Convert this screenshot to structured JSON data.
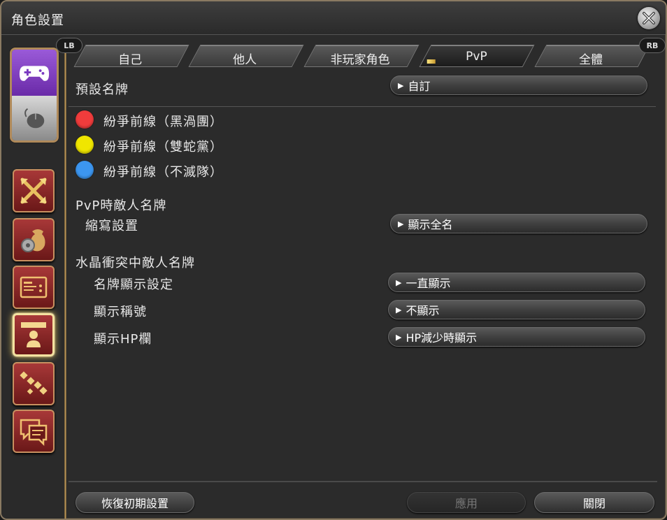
{
  "window": {
    "title": "角色設置"
  },
  "tabs": {
    "lb": "LB",
    "rb": "RB",
    "items": [
      {
        "label": "自己"
      },
      {
        "label": "他人"
      },
      {
        "label": "非玩家角色"
      },
      {
        "label": "PvP",
        "active": true
      },
      {
        "label": "全體"
      }
    ]
  },
  "sidebar": {
    "device_icons": [
      "gamepad-icon",
      "mouse-icon"
    ],
    "category_icons": [
      "arrows-cross-icon",
      "gear-bag-icon",
      "card-icon",
      "nameplate-icon",
      "chain-icon",
      "chat-icon"
    ],
    "selected_index": 3
  },
  "preset": {
    "label": "預設名牌",
    "value": "自訂"
  },
  "frontline": [
    {
      "label": "紛爭前線（黑渦團）",
      "color": "#f03c3c"
    },
    {
      "label": "紛爭前線（雙蛇黨）",
      "color": "#f0e600"
    },
    {
      "label": "紛爭前線（不滅隊）",
      "color": "#3c96f0"
    }
  ],
  "pvp_enemy": {
    "heading": "PvP時敵人名牌",
    "abbrev_label": "縮寫設置",
    "abbrev_value": "顯示全名"
  },
  "crystal": {
    "heading": "水晶衝突中敵人名牌",
    "rows": [
      {
        "label": "名牌顯示設定",
        "value": "一直顯示"
      },
      {
        "label": "顯示稱號",
        "value": "不顯示"
      },
      {
        "label": "顯示HP欄",
        "value": "HP減少時顯示"
      }
    ]
  },
  "footer": {
    "reset": "恢復初期設置",
    "apply": "應用",
    "close": "關閉"
  },
  "colors": {
    "accent": "#c8a060",
    "selected_glow": "#e8c860"
  }
}
